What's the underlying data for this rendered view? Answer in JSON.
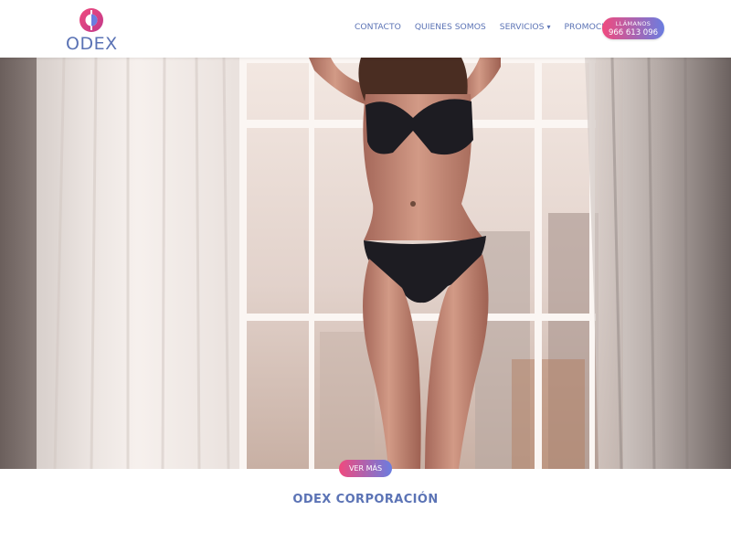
{
  "brand": {
    "name": "ODEX",
    "colors": {
      "pink": "#f04a7e",
      "blue": "#5b73b5",
      "purple": "#6a7de0"
    }
  },
  "nav": {
    "items": [
      {
        "label": "CONTACTO"
      },
      {
        "label": "QUIENES SOMOS"
      },
      {
        "label": "SERVICIOS",
        "icon": "chevron-down-icon"
      },
      {
        "label": "PROMOCIONES"
      }
    ],
    "call": {
      "top": "LLÁMANOS",
      "number": "966 613 096"
    }
  },
  "hero": {
    "image": "woman-in-black-lingerie-by-window",
    "cta": "VER MÁS"
  },
  "section": {
    "title": "ODEX CORPORACIÓN"
  }
}
